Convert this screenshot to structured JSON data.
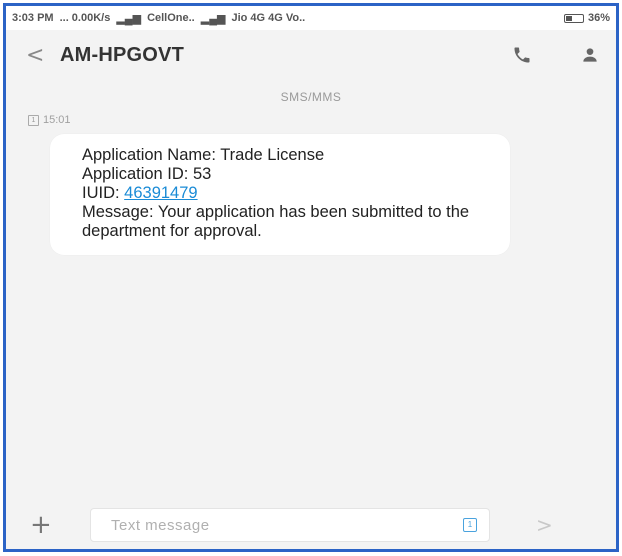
{
  "status_bar": {
    "time": "3:03 PM",
    "data_speed": "... 0.00K/s",
    "carrier_1": "CellOne..",
    "carrier_2": "Jio 4G 4G Vo..",
    "battery": "36%"
  },
  "header": {
    "back_icon": "back-chevron-icon",
    "contact": "AM-HPGOVT",
    "call_icon": "phone-icon",
    "contact_icon": "person-icon"
  },
  "conversation": {
    "channel_label": "SMS/MMS",
    "message": {
      "sim_slot": "1",
      "time": "15:01",
      "lines": [
        "Application Name: Trade License",
        "Application ID: 53"
      ],
      "iuid_label": "IUID: ",
      "iuid_value": "46391479",
      "body": "Message: Your application has been submitted to the department for approval."
    }
  },
  "composer": {
    "attach_icon": "plus-icon",
    "placeholder": "Text message",
    "sim_icon": "sim-card-icon",
    "sim_slot": "1",
    "send_icon": "send-icon"
  },
  "colors": {
    "frame_border": "#2b63c6",
    "link": "#1a8bd6",
    "background": "#f3f3f3"
  }
}
